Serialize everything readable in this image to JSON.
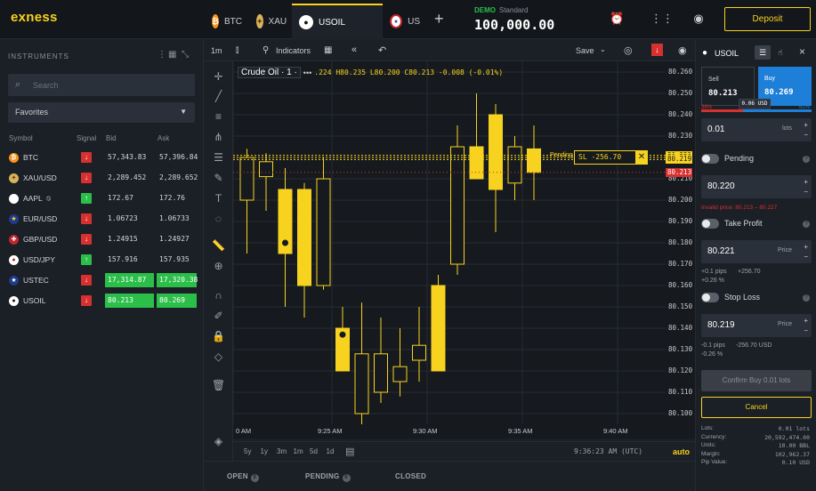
{
  "brand": "exness",
  "tabs": [
    {
      "label": "BTC",
      "icon": "bitcoin-icon"
    },
    {
      "label": "XAU",
      "icon": "gold-flag-icon"
    },
    {
      "label": "USOIL",
      "icon": "oil-drop-icon"
    },
    {
      "label": "US",
      "icon": "us-flag-icon"
    }
  ],
  "account": {
    "mode": "DEMO",
    "type": "Standard",
    "balance": "100,000.00"
  },
  "deposit_label": "Deposit",
  "sidebar": {
    "title": "INSTRUMENTS",
    "search_placeholder": "Search",
    "filter": "Favorites",
    "columns": [
      "Symbol",
      "Signal",
      "Bid",
      "Ask"
    ],
    "rows": [
      {
        "symbol": "BTC",
        "signal": "down",
        "bid": "57,343.83",
        "ask": "57,396.84"
      },
      {
        "symbol": "XAU/USD",
        "signal": "down",
        "bid": "2,289.452",
        "ask": "2,289.652"
      },
      {
        "symbol": "AAPL",
        "signal": "up",
        "bid": "172.67",
        "ask": "172.76"
      },
      {
        "symbol": "EUR/USD",
        "signal": "down",
        "bid": "1.06723",
        "ask": "1.06733"
      },
      {
        "symbol": "GBP/USD",
        "signal": "down",
        "bid": "1.24915",
        "ask": "1.24927"
      },
      {
        "symbol": "USD/JPY",
        "signal": "up",
        "bid": "157.916",
        "ask": "157.935"
      },
      {
        "symbol": "USTEC",
        "signal": "down",
        "bid": "17,314.87",
        "ask": "17,320.38"
      },
      {
        "symbol": "USOIL",
        "signal": "down",
        "bid": "80.213",
        "ask": "80.269"
      }
    ]
  },
  "chart_toolbar": {
    "timeframe": "1m",
    "indicators": "Indicators",
    "save": "Save"
  },
  "chart": {
    "legend_title": "Crude Oil · 1 ·",
    "legend_ohlc": ".224 H80.235 L80.200 C80.213 -0.008 (-0.01%)",
    "y_ticks": [
      "80.260",
      "80.250",
      "80.240",
      "80.230",
      "80.220",
      "80.210",
      "80.200",
      "80.190",
      "80.180",
      "80.170",
      "80.160",
      "80.150",
      "80.140",
      "80.130",
      "80.120",
      "80.110",
      "80.100"
    ],
    "x_ticks": [
      "0 AM",
      "9:25 AM",
      "9:30 AM",
      "9:35 AM",
      "9:40 AM"
    ],
    "price_tags": [
      "80.221",
      "80.220",
      "80.219",
      "80.213"
    ],
    "pending_label": "Pending",
    "sl_label": "SL  -256.70",
    "ylim": [
      80.095,
      80.265
    ]
  },
  "chart_data": {
    "type": "candlestick",
    "candles": [
      {
        "o": 80.2,
        "h": 80.224,
        "l": 80.175,
        "c": 80.22
      },
      {
        "o": 80.211,
        "h": 80.222,
        "l": 80.195,
        "c": 80.218
      },
      {
        "o": 80.205,
        "h": 80.215,
        "l": 80.15,
        "c": 80.175
      },
      {
        "o": 80.205,
        "h": 80.208,
        "l": 80.145,
        "c": 80.16
      },
      {
        "o": 80.16,
        "h": 80.22,
        "l": 80.158,
        "c": 80.21
      },
      {
        "o": 80.14,
        "h": 80.15,
        "l": 80.125,
        "c": 80.12
      },
      {
        "o": 80.1,
        "h": 80.152,
        "l": 80.09,
        "c": 80.128
      },
      {
        "o": 80.11,
        "h": 80.145,
        "l": 80.105,
        "c": 80.128
      },
      {
        "o": 80.115,
        "h": 80.14,
        "l": 80.108,
        "c": 80.122
      },
      {
        "o": 80.125,
        "h": 80.15,
        "l": 80.115,
        "c": 80.132
      },
      {
        "o": 80.16,
        "h": 80.165,
        "l": 80.12,
        "c": 80.12
      },
      {
        "o": 80.17,
        "h": 80.235,
        "l": 80.165,
        "c": 80.225
      },
      {
        "o": 80.225,
        "h": 80.25,
        "l": 80.21,
        "c": 80.21
      },
      {
        "o": 80.24,
        "h": 80.245,
        "l": 80.185,
        "c": 80.205
      },
      {
        "o": 80.208,
        "h": 80.23,
        "l": 80.2,
        "c": 80.225
      },
      {
        "o": 80.224,
        "h": 80.235,
        "l": 80.2,
        "c": 80.213
      }
    ]
  },
  "time_ranges": [
    "5y",
    "1y",
    "3m",
    "1m",
    "5d",
    "1d"
  ],
  "clock": "9:36:23 AM (UTC)",
  "auto_label": "auto",
  "bottom_tabs": [
    {
      "label": "OPEN",
      "count": "0"
    },
    {
      "label": "PENDING",
      "count": "0"
    },
    {
      "label": "CLOSED",
      "count": ""
    }
  ],
  "order": {
    "symbol": "USOIL",
    "sell_label": "Sell",
    "sell_price": "80.213",
    "buy_label": "Buy",
    "buy_price": "80.269",
    "spread": "0.06 USD",
    "sell_pct": "38%",
    "buy_pct": "62%",
    "volume": "0.01",
    "volume_unit": "lots",
    "pending_label": "Pending",
    "pending_price": "80.220",
    "pending_warning": "Invalid price: 80.213 – 80.227",
    "tp_label": "Take Profit",
    "tp_price": "80.221",
    "tp_unit": "Price",
    "tp_pips": "+0.1 pips",
    "tp_usd": "+256.70",
    "tp_pct": "+0.26 %",
    "sl_label": "Stop Loss",
    "sl_price": "80.219",
    "sl_unit": "Price",
    "sl_pips": "-0.1 pips",
    "sl_usd": "-256.70 USD",
    "sl_pct": "-0.26 %",
    "confirm_label": "Confirm Buy 0.01 lots",
    "cancel_label": "Cancel",
    "details": [
      {
        "k": "Lots:",
        "v": "0.01 lots"
      },
      {
        "k": "Currency:",
        "v": "20,592,474.00"
      },
      {
        "k": "Units:",
        "v": "10.00 BBL"
      },
      {
        "k": "Margin:",
        "v": "102,962.37"
      },
      {
        "k": "Pip Value:",
        "v": "0.10 USD"
      }
    ]
  },
  "colors": {
    "accent": "#f7d21f",
    "sell": "#d6302f",
    "buy": "#1e7fd8",
    "green": "#2bbf4a",
    "bg": "#1b1f26"
  }
}
